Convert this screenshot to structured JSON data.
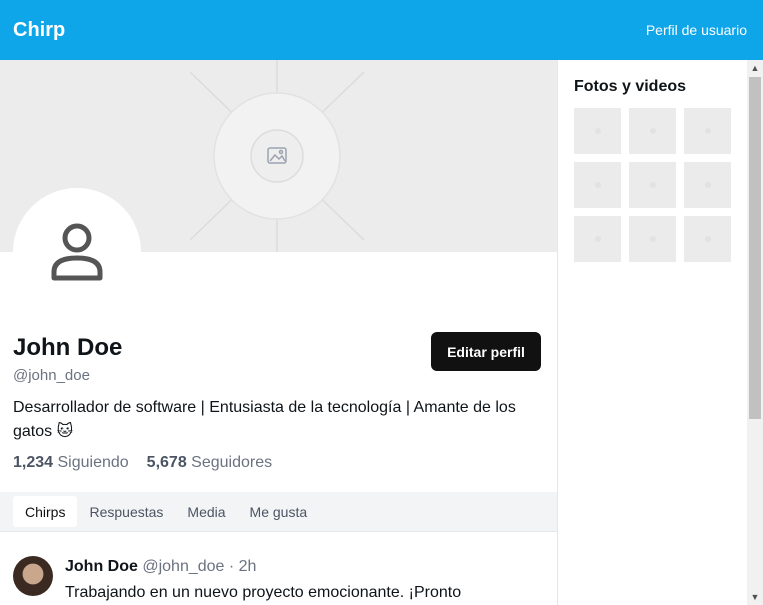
{
  "header": {
    "brand": "Chirp",
    "profile_link": "Perfil de usuario"
  },
  "profile": {
    "name": "John Doe",
    "handle": "@john_doe",
    "edit_label": "Editar perfil",
    "bio": "Desarrollador de software | Entusiasta de la tecnología | Amante de los gatos 🐱",
    "following_count": "1,234",
    "following_label": "Siguiendo",
    "followers_count": "5,678",
    "followers_label": "Seguidores"
  },
  "tabs": [
    {
      "label": "Chirps",
      "active": true
    },
    {
      "label": "Respuestas",
      "active": false
    },
    {
      "label": "Media",
      "active": false
    },
    {
      "label": "Me gusta",
      "active": false
    }
  ],
  "post": {
    "author": "John Doe",
    "meta": "@john_doe · 2h",
    "text": "Trabajando en un nuevo proyecto emocionante. ¡Pronto"
  },
  "sidebar": {
    "title": "Fotos y videos",
    "thumbnail_count": 9
  },
  "icons": {
    "cover": "image-placeholder-icon",
    "avatar": "user-icon"
  }
}
